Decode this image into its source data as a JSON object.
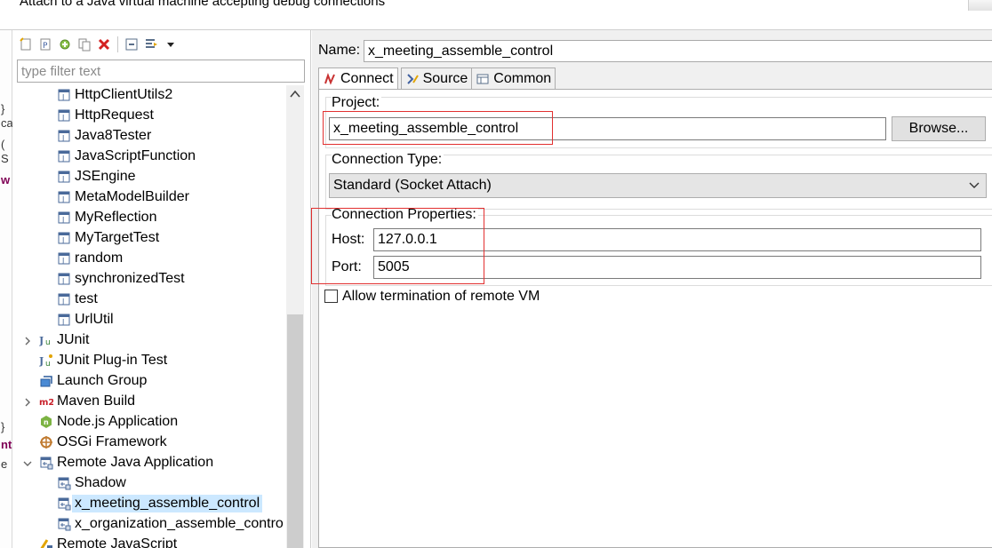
{
  "window": {
    "title": "Attach to a Java virtual machine accepting debug connections"
  },
  "toolbar": {
    "icons": [
      "new-configuration-icon",
      "new-prototype-icon",
      "export-icon",
      "duplicate-icon",
      "delete-icon",
      "collapse-all-icon",
      "filter-icon",
      "view-menu-icon"
    ]
  },
  "filter": {
    "placeholder": "type filter text",
    "value": ""
  },
  "tree": {
    "items": [
      {
        "label": "HttpClientUtils2",
        "icon": "java-app-icon",
        "level": 2
      },
      {
        "label": "HttpRequest",
        "icon": "java-app-icon",
        "level": 2
      },
      {
        "label": "Java8Tester",
        "icon": "java-app-icon",
        "level": 2
      },
      {
        "label": "JavaScriptFunction",
        "icon": "java-app-icon",
        "level": 2
      },
      {
        "label": "JSEngine",
        "icon": "java-app-icon",
        "level": 2
      },
      {
        "label": "MetaModelBuilder",
        "icon": "java-app-icon",
        "level": 2
      },
      {
        "label": "MyReflection",
        "icon": "java-app-icon",
        "level": 2
      },
      {
        "label": "MyTargetTest",
        "icon": "java-app-icon",
        "level": 2
      },
      {
        "label": "random",
        "icon": "java-app-icon",
        "level": 2
      },
      {
        "label": "synchronizedTest",
        "icon": "java-app-icon",
        "level": 2
      },
      {
        "label": "test",
        "icon": "java-app-icon",
        "level": 2
      },
      {
        "label": "UrlUtil",
        "icon": "java-app-icon",
        "level": 2
      },
      {
        "label": "JUnit",
        "icon": "junit-icon",
        "level": 1,
        "twisty": "collapsed"
      },
      {
        "label": "JUnit Plug-in Test",
        "icon": "junit-plugin-icon",
        "level": 1
      },
      {
        "label": "Launch Group",
        "icon": "launch-group-icon",
        "level": 1
      },
      {
        "label": "Maven Build",
        "icon": "maven-icon",
        "level": 1,
        "twisty": "collapsed"
      },
      {
        "label": "Node.js Application",
        "icon": "nodejs-icon",
        "level": 1
      },
      {
        "label": "OSGi Framework",
        "icon": "osgi-icon",
        "level": 1
      },
      {
        "label": "Remote Java Application",
        "icon": "remote-java-icon",
        "level": 1,
        "twisty": "expanded"
      },
      {
        "label": "Shadow",
        "icon": "remote-java-icon",
        "level": 2
      },
      {
        "label": "x_meeting_assemble_control",
        "icon": "remote-java-icon",
        "level": 2,
        "selected": true
      },
      {
        "label": "x_organization_assemble_contro",
        "icon": "remote-java-icon",
        "level": 2
      },
      {
        "label": "Remote JavaScript",
        "icon": "remote-js-icon",
        "level": 1
      }
    ]
  },
  "config": {
    "name_label": "Name:",
    "name_value": "x_meeting_assemble_control",
    "tabs": [
      {
        "label": "Connect",
        "icon": "connect-icon",
        "active": true
      },
      {
        "label": "Source",
        "icon": "source-icon"
      },
      {
        "label": "Common",
        "icon": "common-icon"
      }
    ],
    "project_label": "Project:",
    "project_value": "x_meeting_assemble_control",
    "browse_label": "Browse...",
    "connection_type_label": "Connection Type:",
    "connection_type_value": "Standard (Socket Attach)",
    "connection_props_label": "Connection Properties:",
    "host_label": "Host:",
    "host_value": "127.0.0.1",
    "port_label": "Port:",
    "port_value": "5005",
    "allow_termination_label": "Allow termination of remote VM",
    "allow_termination_checked": false
  },
  "colors": {
    "selection": "#cce8ff",
    "highlight_box": "#e23030",
    "panel_bg": "#f0f0f0"
  }
}
